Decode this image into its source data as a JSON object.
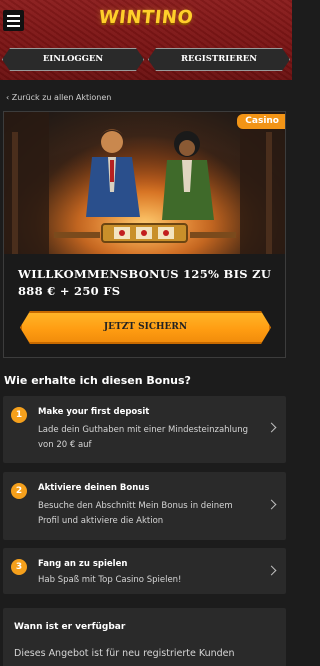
{
  "header": {
    "logo": "WINTINO",
    "login_label": "EINLOGGEN",
    "register_label": "REGISTRIEREN"
  },
  "back_link": "Zurück zu allen Aktionen",
  "promo": {
    "badge": "Casino",
    "title": "WILLKOMMENSBONUS 125% BIS ZU 888 € + 250 FS",
    "cta": "JETZT SICHERN"
  },
  "how_to": {
    "heading": "Wie erhalte ich diesen Bonus?",
    "steps": [
      {
        "number": "1",
        "title": "Make your first deposit",
        "description": "Lade dein Guthaben mit einer Mindesteinzahlung von 20 € auf"
      },
      {
        "number": "2",
        "title": "Aktiviere deinen Bonus",
        "description": "Besuche den Abschnitt Mein Bonus in deinem Profil und aktiviere die Aktion"
      },
      {
        "number": "3",
        "title": "Fang an zu spielen",
        "description": "Hab Spaß mit Top Casino Spielen!"
      }
    ]
  },
  "availability": {
    "title": "Wann ist er verfügbar",
    "text": "Dieses Angebot ist für neu registrierte Kunden"
  },
  "colors": {
    "header_red": "#7a1414",
    "accent_orange": "#f5a01c",
    "logo_yellow": "#ffcf2b",
    "card_bg": "#2a2a2a"
  }
}
